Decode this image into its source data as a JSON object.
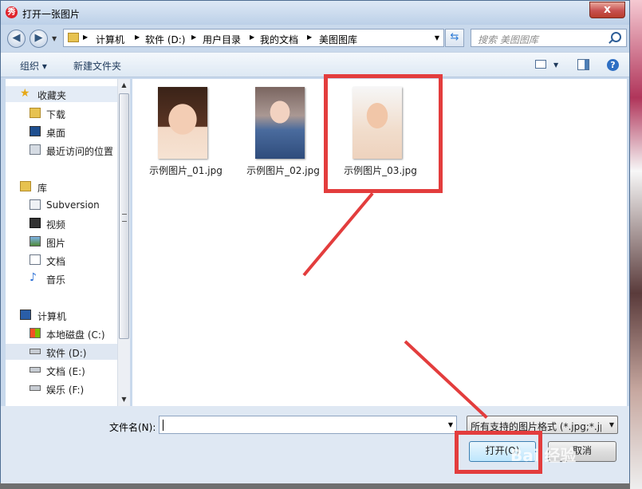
{
  "window": {
    "title": "打开一张图片",
    "app_icon": "秀",
    "close_label": "x"
  },
  "navigation": {
    "breadcrumbs": [
      "计算机",
      "软件 (D:)",
      "用户目录",
      "我的文档",
      "美图图库"
    ],
    "search_placeholder": "搜索 美图图库"
  },
  "toolbar": {
    "organize_label": "组织 ▾",
    "new_folder_label": "新建文件夹"
  },
  "sidebar": {
    "favorites_header": "收藏夹",
    "favorites": [
      "下载",
      "桌面",
      "最近访问的位置"
    ],
    "library_header": "库",
    "libraries": [
      "Subversion",
      "视频",
      "图片",
      "文档",
      "音乐"
    ],
    "computer_header": "计算机",
    "drives": [
      "本地磁盘 (C:)",
      "软件 (D:)",
      "文档 (E:)",
      "娱乐 (F:)"
    ]
  },
  "files": [
    {
      "name": "示例图片_01.jpg"
    },
    {
      "name": "示例图片_02.jpg"
    },
    {
      "name": "示例图片_03.jpg"
    }
  ],
  "bottom": {
    "filename_label": "文件名(N):",
    "filename_value": "",
    "filetype_value": "所有支持的图片格式 (*.jpg;*.jp",
    "open_label": "打开(O)",
    "cancel_label": "取消"
  },
  "colors": {
    "highlight": "#e33d3d",
    "accent": "#2f6fc3"
  }
}
